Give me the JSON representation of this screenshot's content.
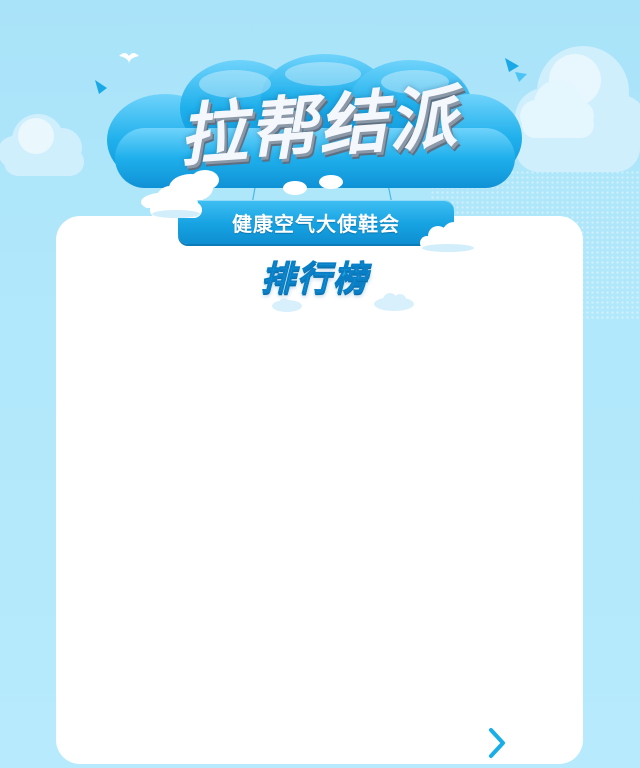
{
  "header": {
    "banner_title": "拉帮结派",
    "subtitle": "健康空气大使鞋会",
    "ranking_title": "排行榜"
  },
  "navigation": {
    "next_icon": "chevron-right-icon"
  },
  "colors": {
    "sky": "#aee6fb",
    "panel": "#ffffff",
    "accent_blue": "#16a2e2",
    "title_fill": "#f4f7fb",
    "chevron": "#18aee8"
  }
}
